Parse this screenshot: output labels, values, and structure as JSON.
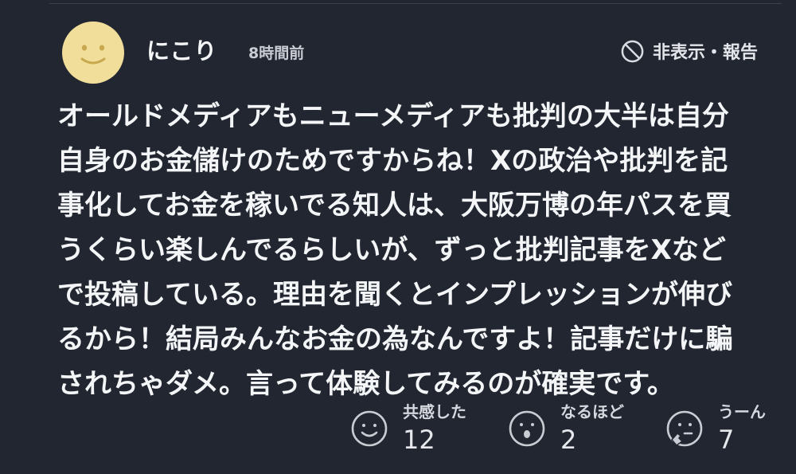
{
  "user": {
    "name": "にこり",
    "time_ago": "8時間前",
    "avatar_icon": "smiley-avatar",
    "avatar_color": "#F1DE9A"
  },
  "actions": {
    "hide_report_label": "非表示・報告",
    "hide_report_icon": "prohibited-icon"
  },
  "comment": {
    "lines": [
      "オールドメディアもニューメディアも批判の大半は自分",
      "自身のお金儲けのためですからね！Xの政治や批判を記",
      "事化してお金を稼いでる知人は、大阪万博の年パスを買",
      "うくらい楽しんでるらしいが、ずっと批判記事をXなど",
      "で投稿している。理由を聞くとインプレッションが伸び",
      "るから！結局みんなお金の為なんですよ！記事だけに騙",
      "されちゃダメ。言って体験してみるのが確実です。"
    ]
  },
  "reactions": [
    {
      "label": "共感した",
      "count": "12",
      "icon": "smile-face-icon"
    },
    {
      "label": "なるほど",
      "count": "2",
      "icon": "surprised-face-icon"
    },
    {
      "label": "うーん",
      "count": "7",
      "icon": "thinking-face-icon"
    }
  ],
  "colors": {
    "background": "#212631",
    "text": "#F4F5F7",
    "muted": "#C9CCD3"
  }
}
